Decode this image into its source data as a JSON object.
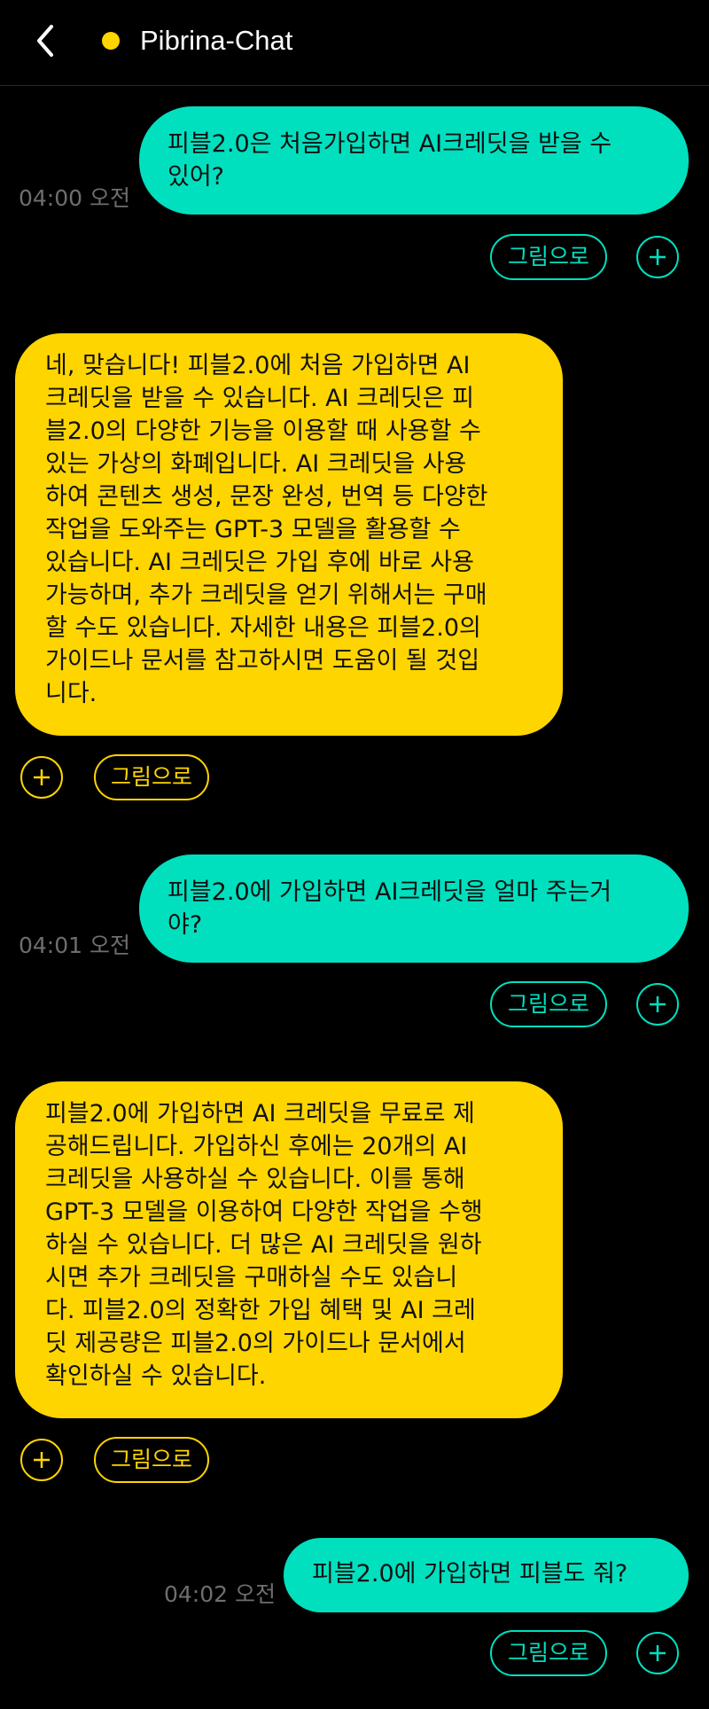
{
  "header": {
    "title": "Pibrina-Chat",
    "back_icon": "chevron-left-icon",
    "status_color": "#ffd500"
  },
  "colors": {
    "user_bubble": "#00e0bf",
    "bot_bubble": "#ffd500",
    "background": "#000000",
    "timestamp": "#6e6e6e"
  },
  "messages": [
    {
      "role": "user",
      "text": "피블2.0은 처음가입하면 AI크레딧을 받을 수\n있어?",
      "time": "04:00 오전",
      "draw_button": "그림으로",
      "add_icon": "plus-icon"
    },
    {
      "role": "bot",
      "text": "네, 맞습니다! 피블2.0에 처음 가입하면 AI\n크레딧을 받을 수 있습니다. AI 크레딧은 피\n블2.0의 다양한 기능을 이용할 때 사용할 수\n있는 가상의 화폐입니다. AI 크레딧을 사용\n하여 콘텐츠 생성, 문장 완성, 번역 등 다양한\n작업을 도와주는 GPT-3 모델을 활용할 수\n있습니다. AI 크레딧은 가입 후에 바로 사용\n가능하며, 추가 크레딧을 얻기 위해서는 구매\n할 수도 있습니다. 자세한 내용은 피블2.0의\n가이드나 문서를 참고하시면 도움이 될 것입\n니다.",
      "draw_button": "그림으로",
      "add_icon": "plus-icon"
    },
    {
      "role": "user",
      "text": "피블2.0에 가입하면 AI크레딧을 얼마 주는거\n야?",
      "time": "04:01 오전",
      "draw_button": "그림으로",
      "add_icon": "plus-icon"
    },
    {
      "role": "bot",
      "text": "피블2.0에 가입하면 AI 크레딧을 무료로 제\n공해드립니다. 가입하신 후에는 20개의 AI\n크레딧을 사용하실 수 있습니다. 이를 통해\nGPT-3 모델을 이용하여 다양한 작업을 수행\n하실 수 있습니다. 더 많은 AI 크레딧을 원하\n시면 추가 크레딧을 구매하실 수도 있습니\n다. 피블2.0의 정확한 가입 혜택 및 AI 크레\n딧 제공량은 피블2.0의 가이드나 문서에서\n확인하실 수 있습니다.",
      "draw_button": "그림으로",
      "add_icon": "plus-icon"
    },
    {
      "role": "user",
      "text": "피블2.0에 가입하면 피블도 줘?",
      "time": "04:02 오전",
      "draw_button": "그림으로",
      "add_icon": "plus-icon"
    }
  ]
}
